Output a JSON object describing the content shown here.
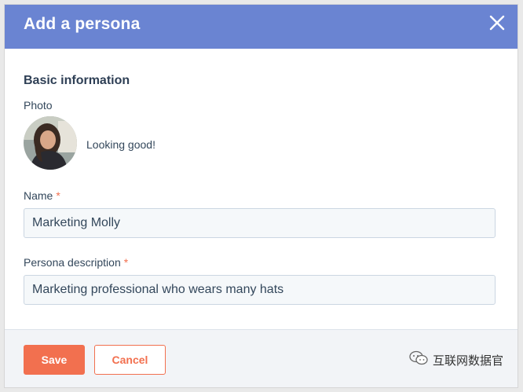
{
  "dialog": {
    "title": "Add a persona",
    "close_icon": "close-icon",
    "header_color": "#6a84d2"
  },
  "form": {
    "section_title": "Basic information",
    "photo_label": "Photo",
    "avatar_caption": "Looking good!",
    "name_label": "Name",
    "name_value": "Marketing Molly",
    "description_label": "Persona description",
    "description_value": "Marketing professional who wears many hats",
    "required_marker": "*"
  },
  "footer": {
    "save_label": "Save",
    "cancel_label": "Cancel",
    "accent_color": "#f2704f"
  },
  "watermark": {
    "text": "互联网数据官",
    "icon": "wechat-icon"
  }
}
